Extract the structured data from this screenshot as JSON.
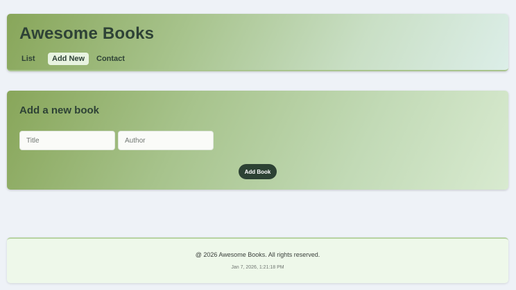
{
  "header": {
    "brand": "Awesome Books",
    "nav": {
      "list": "List",
      "add_new": "Add New",
      "contact": "Contact"
    }
  },
  "form": {
    "title": "Add a new book",
    "title_field": {
      "value": "",
      "placeholder": "Title"
    },
    "author_field": {
      "value": "",
      "placeholder": "Author"
    },
    "submit_label": "Add Book"
  },
  "footer": {
    "copyright": "@ 2026 Awesome Books. All rights reserved.",
    "timestamp": "Jan 7, 2026, 1:21:18 PM"
  },
  "colors": {
    "accent_dark": "#2d4234",
    "header_gradient_start": "#88a65a",
    "header_gradient_end": "#dceee8",
    "active_nav_bg": "#e8f3e0",
    "page_bg": "#eef2f7",
    "footer_bg": "#eef8ea"
  }
}
